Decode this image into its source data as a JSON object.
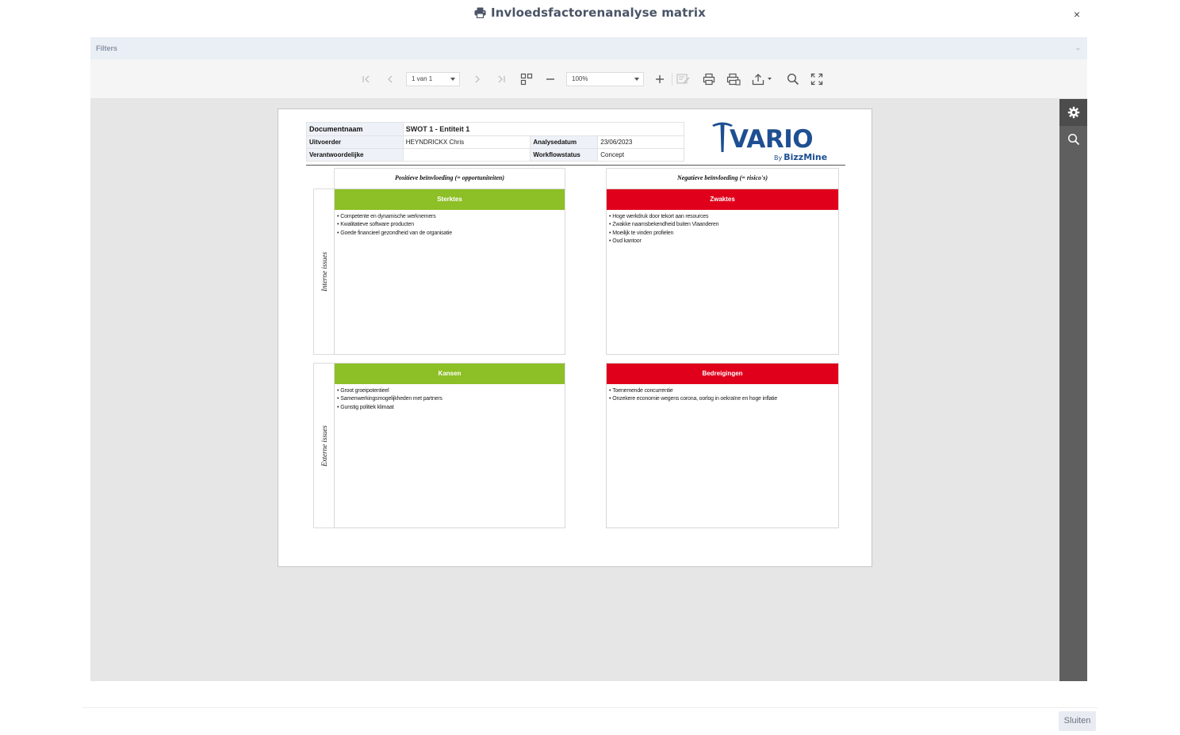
{
  "modal": {
    "title": "Invloedsfactorenanalyse matrix",
    "close_label": "×",
    "footer_button": "Sluiten"
  },
  "filters": {
    "label": "Filters",
    "chevron": "⌄"
  },
  "toolbar": {
    "page_select": "1 van 1",
    "zoom_select": "100%",
    "icons": [
      "first-page-icon",
      "previous-page-icon",
      "next-page-icon",
      "last-page-icon",
      "multipage-icon",
      "zoom-out-icon",
      "zoom-in-icon",
      "edit-fields-icon",
      "print-icon",
      "print-page-icon",
      "export-icon",
      "search-icon",
      "fullscreen-icon"
    ]
  },
  "side_rail": {
    "icons": [
      "gear-icon",
      "search-icon"
    ]
  },
  "report": {
    "meta": {
      "documentnaam_label": "Documentnaam",
      "documentnaam": "SWOT 1 - Entiteit 1",
      "uitvoerder_label": "Uitvoerder",
      "uitvoerder": "HEYNDRICKX Chris",
      "analysedatum_label": "Analysedatum",
      "analysedatum": "23/06/2023",
      "verantwoordelijke_label": "Verantwoordelijke",
      "verantwoordelijke": "",
      "workflowstatus_label": "Workflowstatus",
      "workflowstatus": "Concept"
    },
    "logo": {
      "name": "VARIO",
      "by": "By",
      "brand": "BizzMine",
      "color": "#1e4f92"
    },
    "column_headers": {
      "positive": "Positieve beïnvloeding (= opportuniteiten)",
      "negative": "Negatieve beïnvloeding (= risico's)"
    },
    "row_labels": {
      "internal": "Interne issues",
      "external": "Externe issues"
    },
    "quadrants": {
      "sterktes": {
        "title": "Sterktes",
        "color": "#8dbf26",
        "items": [
          "Competente en dynamische werknemers",
          "Kwalitatieve software producten",
          "Goede financieel gezondheid van de organisatie"
        ]
      },
      "zwaktes": {
        "title": "Zwaktes",
        "color": "#e0001b",
        "items": [
          "Hoge werkdruk door tekort aan resources",
          "Zwakke naamsbekendheid buiten Vlaanderen",
          "Moeilijk te vinden profielen",
          "Oud kantoor"
        ]
      },
      "kansen": {
        "title": "Kansen",
        "color": "#8dbf26",
        "items": [
          "Groot groeipotentieel",
          "Samenwerkingsmogelijkheden met partners",
          "Gunstig politiek klimaat"
        ]
      },
      "bedreigingen": {
        "title": "Bedreigingen",
        "color": "#e0001b",
        "items": [
          "Toenemende concurrentie",
          "Onzekere economie wegens corona, oorlog in oekraïne en hoge inflatie"
        ]
      }
    }
  }
}
